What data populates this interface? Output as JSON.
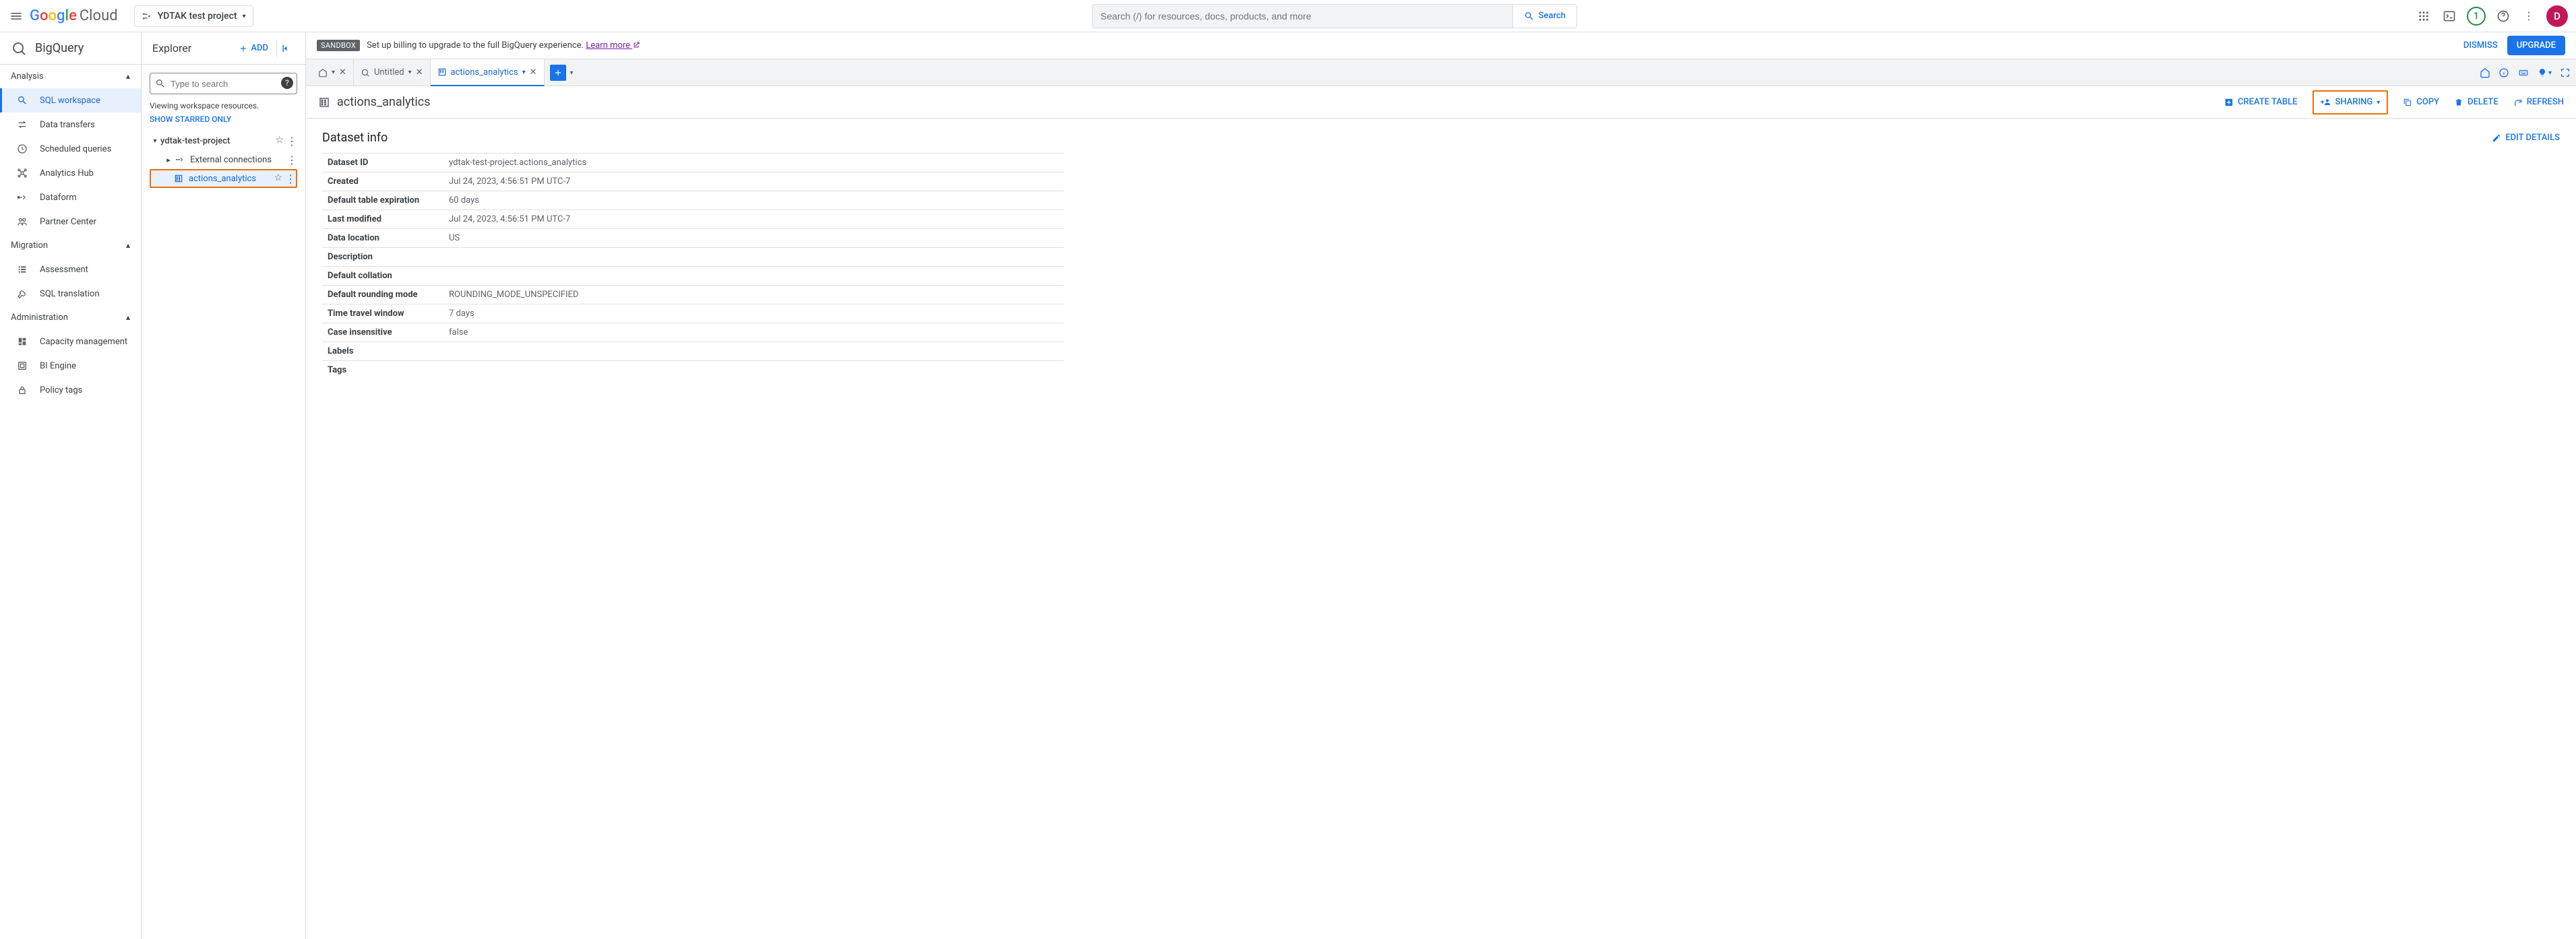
{
  "header": {
    "logo_text_parts": [
      "G",
      "o",
      "o",
      "g",
      "l",
      "e",
      " Cloud"
    ],
    "project_name": "YDTAK test project",
    "search_placeholder": "Search (/) for resources, docs, products, and more",
    "search_button": "Search",
    "trial_badge": "1",
    "avatar_letter": "D"
  },
  "bq_title": "BigQuery",
  "left_nav": {
    "sections": [
      {
        "title": "Analysis",
        "items": [
          {
            "label": "SQL workspace",
            "icon": "search",
            "active": true
          },
          {
            "label": "Data transfers",
            "icon": "transfer"
          },
          {
            "label": "Scheduled queries",
            "icon": "clock"
          },
          {
            "label": "Analytics Hub",
            "icon": "hub"
          },
          {
            "label": "Dataform",
            "icon": "dataform"
          },
          {
            "label": "Partner Center",
            "icon": "partner"
          }
        ]
      },
      {
        "title": "Migration",
        "items": [
          {
            "label": "Assessment",
            "icon": "list"
          },
          {
            "label": "SQL translation",
            "icon": "wrench"
          }
        ]
      },
      {
        "title": "Administration",
        "items": [
          {
            "label": "Capacity management",
            "icon": "dashboard"
          },
          {
            "label": "BI Engine",
            "icon": "engine"
          },
          {
            "label": "Policy tags",
            "icon": "lock"
          }
        ]
      }
    ]
  },
  "explorer": {
    "title": "Explorer",
    "add_label": "ADD",
    "search_placeholder": "Type to search",
    "viewing_text": "Viewing workspace resources.",
    "show_starred": "SHOW STARRED ONLY",
    "tree": {
      "project": "ydtak-test-project",
      "ext_conn": "External connections",
      "dataset": "actions_analytics"
    }
  },
  "banner": {
    "badge": "SANDBOX",
    "text_prefix": "Set up billing to upgrade to the full BigQuery experience. ",
    "learn_more": "Learn more",
    "dismiss": "DISMISS",
    "upgrade": "UPGRADE"
  },
  "tabs": {
    "untitled": "Untitled",
    "dataset_tab": "actions_analytics"
  },
  "toolbar": {
    "title": "actions_analytics",
    "create_table": "CREATE TABLE",
    "sharing": "SHARING",
    "copy": "COPY",
    "delete": "DELETE",
    "refresh": "REFRESH"
  },
  "dataset_info": {
    "section_title": "Dataset info",
    "edit_details": "EDIT DETAILS",
    "rows": [
      {
        "k": "Dataset ID",
        "v": "ydtak-test-project.actions_analytics"
      },
      {
        "k": "Created",
        "v": "Jul 24, 2023, 4:56:51 PM UTC-7"
      },
      {
        "k": "Default table expiration",
        "v": "60 days"
      },
      {
        "k": "Last modified",
        "v": "Jul 24, 2023, 4:56:51 PM UTC-7"
      },
      {
        "k": "Data location",
        "v": "US"
      },
      {
        "k": "Description",
        "v": ""
      },
      {
        "k": "Default collation",
        "v": ""
      },
      {
        "k": "Default rounding mode",
        "v": "ROUNDING_MODE_UNSPECIFIED"
      },
      {
        "k": "Time travel window",
        "v": "7 days"
      },
      {
        "k": "Case insensitive",
        "v": "false"
      },
      {
        "k": "Labels",
        "v": ""
      },
      {
        "k": "Tags",
        "v": ""
      }
    ]
  }
}
